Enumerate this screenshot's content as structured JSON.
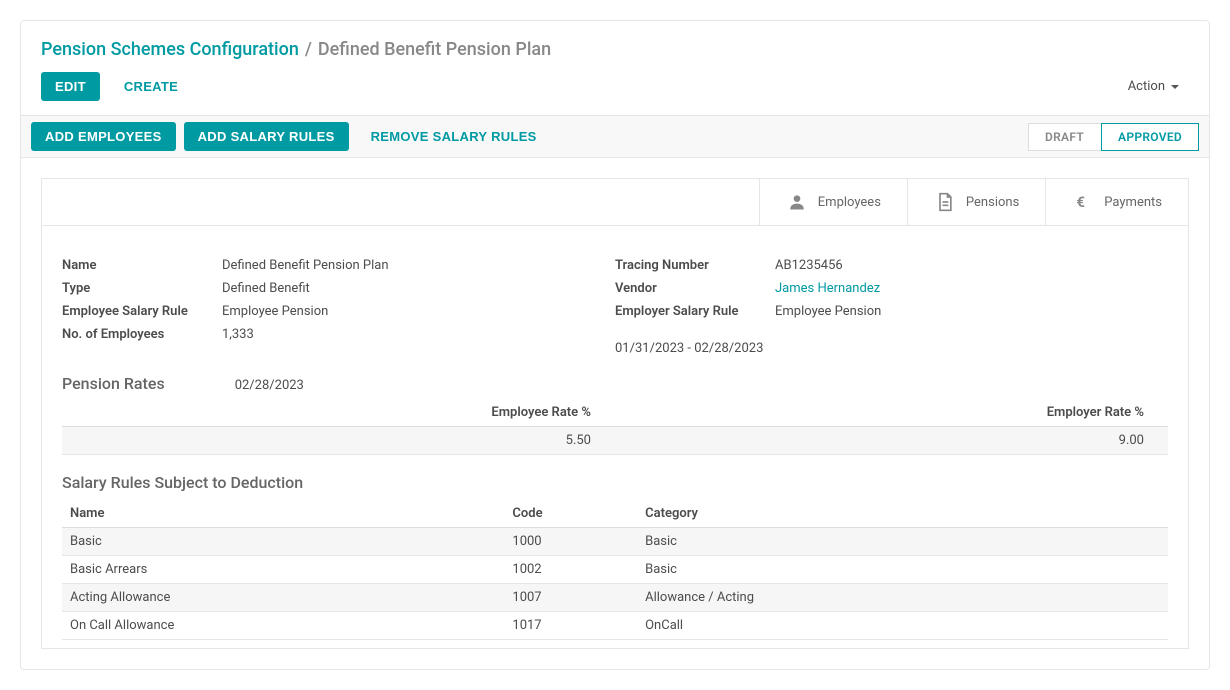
{
  "breadcrumb": {
    "root": "Pension Schemes Configuration",
    "current": "Defined Benefit Pension Plan"
  },
  "toolbar": {
    "edit": "EDIT",
    "create": "CREATE",
    "action": "Action"
  },
  "actions": {
    "add_employees": "ADD EMPLOYEES",
    "add_salary_rules": "ADD SALARY RULES",
    "remove_salary_rules": "REMOVE SALARY RULES"
  },
  "status": {
    "draft": "DRAFT",
    "approved": "APPROVED"
  },
  "tabs": {
    "employees": "Employees",
    "pensions": "Pensions",
    "payments": "Payments"
  },
  "fields": {
    "name": {
      "label": "Name",
      "value": "Defined Benefit Pension Plan"
    },
    "type": {
      "label": "Type",
      "value": "Defined Benefit"
    },
    "employee_salary_rule": {
      "label": "Employee Salary Rule",
      "value": "Employee Pension"
    },
    "no_of_employees": {
      "label": "No. of Employees",
      "value": "1,333"
    },
    "tracing_number": {
      "label": "Tracing Number",
      "value": "AB1235456"
    },
    "vendor": {
      "label": "Vendor",
      "value": "James Hernandez"
    },
    "employer_salary_rule": {
      "label": "Employer Salary Rule",
      "value": "Employee Pension"
    },
    "date_range": {
      "value": "01/31/2023 - 02/28/2023"
    }
  },
  "pension_rates": {
    "title": "Pension Rates",
    "date": "02/28/2023",
    "columns": [
      "Employee Rate %",
      "Employer Rate %"
    ],
    "rows": [
      {
        "employee": "5.50",
        "employer": "9.00"
      }
    ]
  },
  "salary_rules": {
    "title": "Salary Rules Subject to Deduction",
    "columns": [
      "Name",
      "Code",
      "Category"
    ],
    "rows": [
      {
        "name": "Basic",
        "code": "1000",
        "category": "Basic"
      },
      {
        "name": "Basic Arrears",
        "code": "1002",
        "category": "Basic"
      },
      {
        "name": "Acting Allowance",
        "code": "1007",
        "category": "Allowance / Acting"
      },
      {
        "name": "On Call Allowance",
        "code": "1017",
        "category": "OnCall"
      }
    ]
  }
}
